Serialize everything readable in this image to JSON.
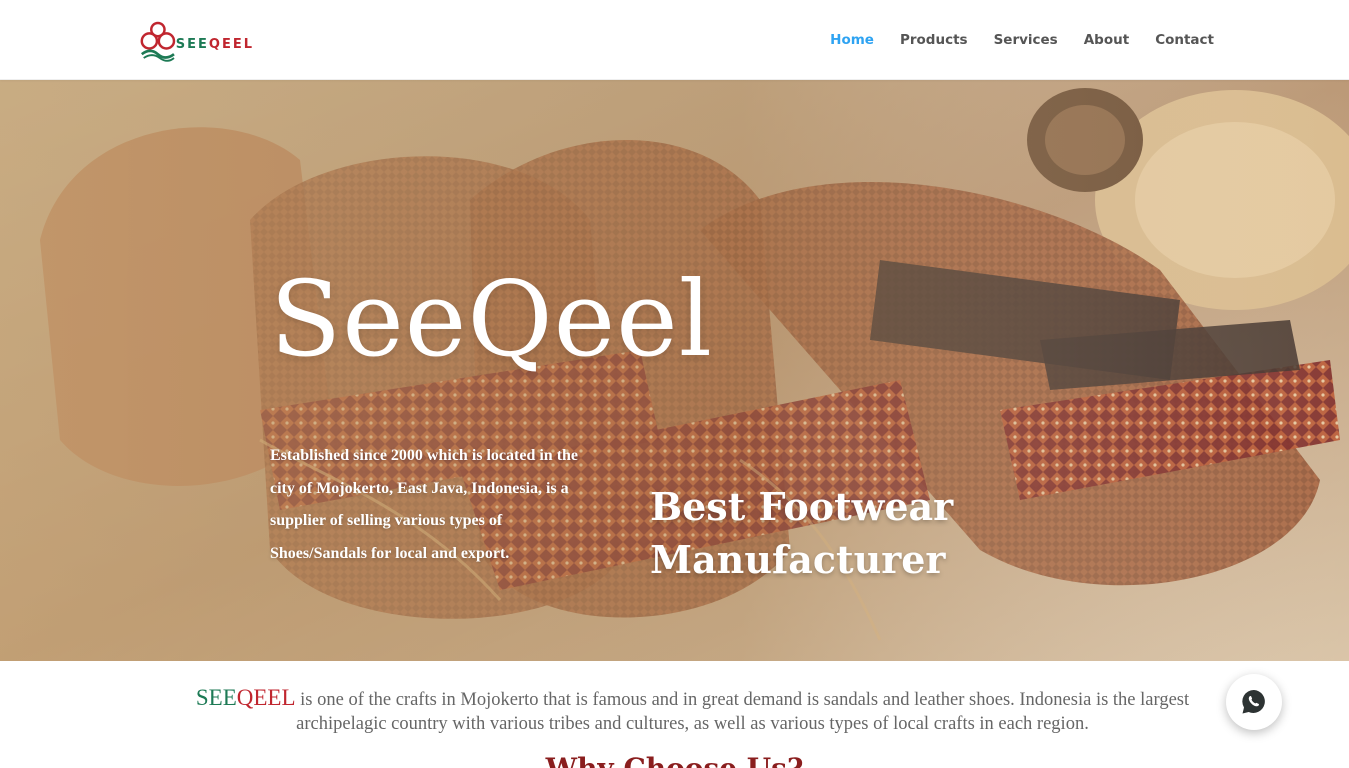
{
  "logo": {
    "part1": "SEE",
    "part2": "QEEL"
  },
  "nav": {
    "items": [
      {
        "label": "Home",
        "active": true
      },
      {
        "label": "Products",
        "active": false
      },
      {
        "label": "Services",
        "active": false
      },
      {
        "label": "About",
        "active": false
      },
      {
        "label": "Contact",
        "active": false
      }
    ]
  },
  "hero": {
    "title": "SeeQeel",
    "description": "Established since 2000 which is located in the city of Mojokerto, East Java, Indonesia, is a supplier of selling various types of Shoes/Sandals for local and export.",
    "tagline": "Best Footwear Manufacturer"
  },
  "intro": {
    "brand_part1": "SEE",
    "brand_part2": "QEEL",
    "text": " is one of the crafts in Mojokerto that is famous and in great demand is sandals and leather shoes. Indonesia is the largest archipelagic country with various tribes and cultures, as well as various types of local crafts in each region."
  },
  "why_heading": "Why Choose Us?",
  "colors": {
    "accent": "#2ea3f2",
    "brand_green": "#1d7a55",
    "brand_red": "#c0262f",
    "whatsapp": "#25d366"
  },
  "icons": {
    "floating_button": "whatsapp-icon"
  }
}
